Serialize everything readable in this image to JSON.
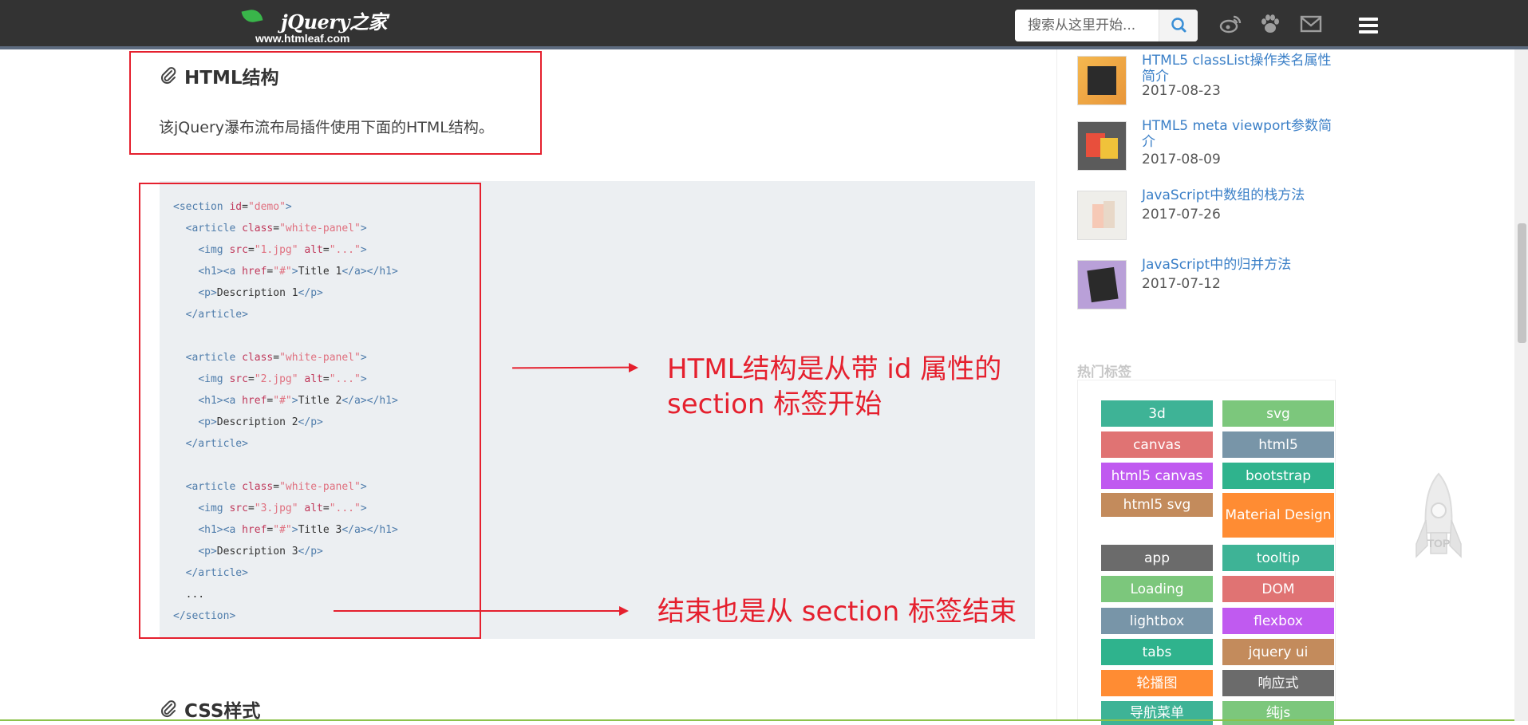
{
  "header": {
    "logo_brand": "jQuery之家",
    "logo_url": "www.htmleaf.com",
    "search_placeholder": "搜索从这里开始...",
    "icons": [
      "search-icon",
      "weibo-icon",
      "paw-icon",
      "mail-icon",
      "menu-icon"
    ]
  },
  "article": {
    "section1_title": "HTML结构",
    "section1_text": "该jQuery瀑布流布局插件使用下面的HTML结构。",
    "section2_title": "CSS样式",
    "code_lines": [
      [
        {
          "c": "t",
          "s": "<section "
        },
        {
          "c": "a",
          "s": "id"
        },
        {
          "c": "",
          "s": "="
        },
        {
          "c": "v",
          "s": "\"demo\""
        },
        {
          "c": "t",
          "s": ">"
        }
      ],
      [
        {
          "c": "",
          "s": "  "
        },
        {
          "c": "t",
          "s": "<article "
        },
        {
          "c": "a",
          "s": "class"
        },
        {
          "c": "",
          "s": "="
        },
        {
          "c": "v",
          "s": "\"white-panel\""
        },
        {
          "c": "t",
          "s": ">"
        }
      ],
      [
        {
          "c": "",
          "s": "    "
        },
        {
          "c": "t",
          "s": "<img "
        },
        {
          "c": "a",
          "s": "src"
        },
        {
          "c": "",
          "s": "="
        },
        {
          "c": "v",
          "s": "\"1.jpg\""
        },
        {
          "c": "",
          "s": " "
        },
        {
          "c": "a",
          "s": "alt"
        },
        {
          "c": "",
          "s": "="
        },
        {
          "c": "v",
          "s": "\"...\""
        },
        {
          "c": "t",
          "s": ">"
        }
      ],
      [
        {
          "c": "",
          "s": "    "
        },
        {
          "c": "t",
          "s": "<h1><a "
        },
        {
          "c": "a",
          "s": "href"
        },
        {
          "c": "",
          "s": "="
        },
        {
          "c": "v",
          "s": "\"#\""
        },
        {
          "c": "t",
          "s": ">"
        },
        {
          "c": "",
          "s": "Title 1"
        },
        {
          "c": "t",
          "s": "</a></h1>"
        }
      ],
      [
        {
          "c": "",
          "s": "    "
        },
        {
          "c": "t",
          "s": "<p>"
        },
        {
          "c": "",
          "s": "Description 1"
        },
        {
          "c": "t",
          "s": "</p>"
        }
      ],
      [
        {
          "c": "",
          "s": "  "
        },
        {
          "c": "t",
          "s": "</article>"
        }
      ],
      [
        {
          "c": "",
          "s": " "
        }
      ],
      [
        {
          "c": "",
          "s": "  "
        },
        {
          "c": "t",
          "s": "<article "
        },
        {
          "c": "a",
          "s": "class"
        },
        {
          "c": "",
          "s": "="
        },
        {
          "c": "v",
          "s": "\"white-panel\""
        },
        {
          "c": "t",
          "s": ">"
        }
      ],
      [
        {
          "c": "",
          "s": "    "
        },
        {
          "c": "t",
          "s": "<img "
        },
        {
          "c": "a",
          "s": "src"
        },
        {
          "c": "",
          "s": "="
        },
        {
          "c": "v",
          "s": "\"2.jpg\""
        },
        {
          "c": "",
          "s": " "
        },
        {
          "c": "a",
          "s": "alt"
        },
        {
          "c": "",
          "s": "="
        },
        {
          "c": "v",
          "s": "\"...\""
        },
        {
          "c": "t",
          "s": ">"
        }
      ],
      [
        {
          "c": "",
          "s": "    "
        },
        {
          "c": "t",
          "s": "<h1><a "
        },
        {
          "c": "a",
          "s": "href"
        },
        {
          "c": "",
          "s": "="
        },
        {
          "c": "v",
          "s": "\"#\""
        },
        {
          "c": "t",
          "s": ">"
        },
        {
          "c": "",
          "s": "Title 2"
        },
        {
          "c": "t",
          "s": "</a></h1>"
        }
      ],
      [
        {
          "c": "",
          "s": "    "
        },
        {
          "c": "t",
          "s": "<p>"
        },
        {
          "c": "",
          "s": "Description 2"
        },
        {
          "c": "t",
          "s": "</p>"
        }
      ],
      [
        {
          "c": "",
          "s": "  "
        },
        {
          "c": "t",
          "s": "</article>"
        }
      ],
      [
        {
          "c": "",
          "s": " "
        }
      ],
      [
        {
          "c": "",
          "s": "  "
        },
        {
          "c": "t",
          "s": "<article "
        },
        {
          "c": "a",
          "s": "class"
        },
        {
          "c": "",
          "s": "="
        },
        {
          "c": "v",
          "s": "\"white-panel\""
        },
        {
          "c": "t",
          "s": ">"
        }
      ],
      [
        {
          "c": "",
          "s": "    "
        },
        {
          "c": "t",
          "s": "<img "
        },
        {
          "c": "a",
          "s": "src"
        },
        {
          "c": "",
          "s": "="
        },
        {
          "c": "v",
          "s": "\"3.jpg\""
        },
        {
          "c": "",
          "s": " "
        },
        {
          "c": "a",
          "s": "alt"
        },
        {
          "c": "",
          "s": "="
        },
        {
          "c": "v",
          "s": "\"...\""
        },
        {
          "c": "t",
          "s": ">"
        }
      ],
      [
        {
          "c": "",
          "s": "    "
        },
        {
          "c": "t",
          "s": "<h1><a "
        },
        {
          "c": "a",
          "s": "href"
        },
        {
          "c": "",
          "s": "="
        },
        {
          "c": "v",
          "s": "\"#\""
        },
        {
          "c": "t",
          "s": ">"
        },
        {
          "c": "",
          "s": "Title 3"
        },
        {
          "c": "t",
          "s": "</a></h1>"
        }
      ],
      [
        {
          "c": "",
          "s": "    "
        },
        {
          "c": "t",
          "s": "<p>"
        },
        {
          "c": "",
          "s": "Description 3"
        },
        {
          "c": "t",
          "s": "</p>"
        }
      ],
      [
        {
          "c": "",
          "s": "  "
        },
        {
          "c": "t",
          "s": "</article>"
        }
      ],
      [
        {
          "c": "",
          "s": "  ..."
        }
      ],
      [
        {
          "c": "t",
          "s": "</section>"
        }
      ]
    ],
    "annotation1_line1": "HTML结构是从带 id 属性的",
    "annotation1_line2": "section 标签开始",
    "annotation2": "结束也是从 section 标签结束"
  },
  "sidebar": {
    "posts": [
      {
        "title": "HTML5 classList操作类名属性简介",
        "date": "2017-08-23"
      },
      {
        "title": "HTML5 meta viewport参数简介",
        "date": "2017-08-09"
      },
      {
        "title": "JavaScript中数组的栈方法",
        "date": "2017-07-26"
      },
      {
        "title": "JavaScript中的归并方法",
        "date": "2017-07-12"
      }
    ],
    "tags_heading": "热门标签",
    "tags": [
      {
        "label": "3d",
        "color": "#3eb396"
      },
      {
        "label": "svg",
        "color": "#7cc77c"
      },
      {
        "label": "canvas",
        "color": "#e07373"
      },
      {
        "label": "html5",
        "color": "#7895a8"
      },
      {
        "label": "html5 canvas",
        "color": "#c05af0"
      },
      {
        "label": "bootstrap",
        "color": "#2fb38d"
      },
      {
        "label": "html5 svg",
        "color": "#c38b5c"
      },
      {
        "label": "Material Design",
        "color": "#ff8c33"
      },
      {
        "label": "app",
        "color": "#6b6b6b"
      },
      {
        "label": "tooltip",
        "color": "#3eb396"
      },
      {
        "label": "Loading",
        "color": "#7cc77c"
      },
      {
        "label": "DOM",
        "color": "#e07373"
      },
      {
        "label": "lightbox",
        "color": "#7895a8"
      },
      {
        "label": "flexbox",
        "color": "#c05af0"
      },
      {
        "label": "tabs",
        "color": "#2fb38d"
      },
      {
        "label": "jquery ui",
        "color": "#c38b5c"
      },
      {
        "label": "轮播图",
        "color": "#ff8c33"
      },
      {
        "label": "响应式",
        "color": "#6b6b6b"
      },
      {
        "label": "导航菜单",
        "color": "#3eb396"
      },
      {
        "label": "纯js",
        "color": "#7cc77c"
      }
    ],
    "totop_label": "TOP"
  }
}
